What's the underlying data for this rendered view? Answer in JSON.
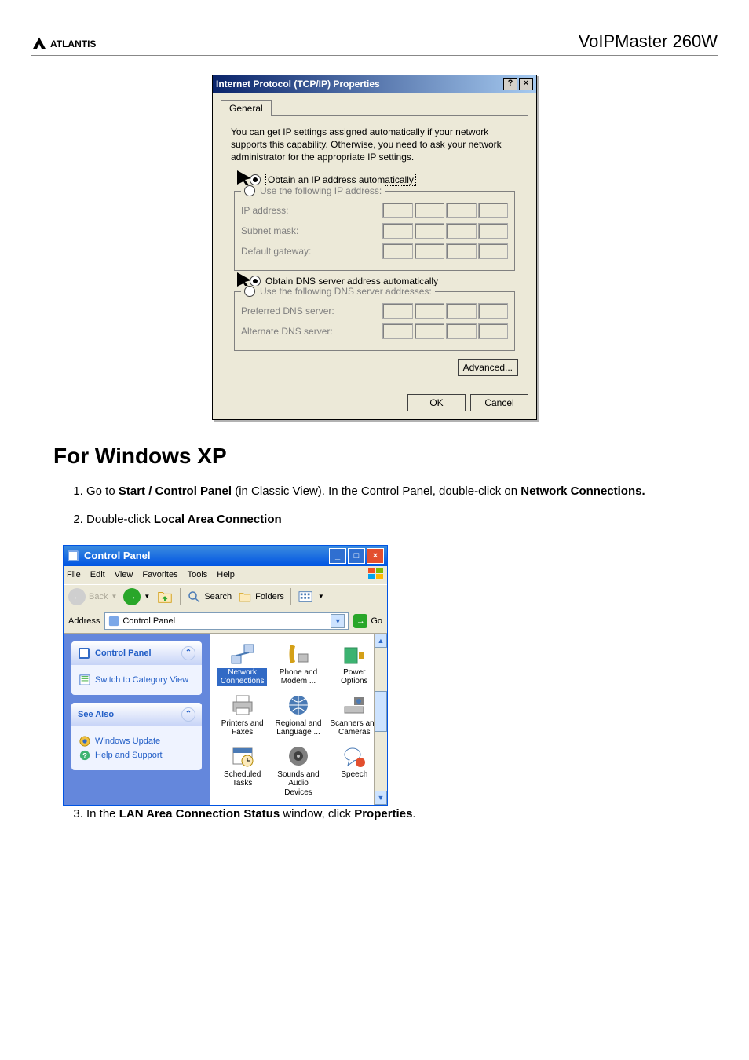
{
  "header": {
    "logo_brand": "ATLANTIS",
    "product": "VoIPMaster 260W"
  },
  "dialog": {
    "title": "Internet Protocol (TCP/IP) Properties",
    "help_btn": "?",
    "close_btn": "×",
    "tab": "General",
    "description": "You can get IP settings assigned automatically if your network supports this capability. Otherwise, you need to ask your network administrator for the appropriate IP settings.",
    "ip_auto": "Obtain an IP address automatically",
    "ip_manual": "Use the following IP address:",
    "ip_label": "IP address:",
    "subnet_label": "Subnet mask:",
    "gateway_label": "Default gateway:",
    "dns_auto": "Obtain DNS server address automatically",
    "dns_manual": "Use the following DNS server addresses:",
    "pref_dns": "Preferred DNS server:",
    "alt_dns": "Alternate DNS server:",
    "advanced": "Advanced...",
    "ok": "OK",
    "cancel": "Cancel"
  },
  "section_heading": "For Windows XP",
  "steps": {
    "s1a": "Go to ",
    "s1b": "Start / Control Panel",
    "s1c": " (in Classic View). In the Control Panel, double-click on ",
    "s1d": "Network Connections.",
    "s2a": "Double-click ",
    "s2b": "Local Area Connection",
    "s3a": "In the ",
    "s3b": "LAN Area Connection Status",
    "s3c": " window, click ",
    "s3d": "Properties",
    "s3e": "."
  },
  "cp": {
    "title": "Control Panel",
    "menus": {
      "file": "File",
      "edit": "Edit",
      "view": "View",
      "favorites": "Favorites",
      "tools": "Tools",
      "help": "Help"
    },
    "tb": {
      "back": "Back",
      "search": "Search",
      "folders": "Folders"
    },
    "address_lbl": "Address",
    "address_val": "Control Panel",
    "go": "Go",
    "side_cp": "Control Panel",
    "side_switch": "Switch to Category View",
    "side_see": "See Also",
    "side_wu": "Windows Update",
    "side_help": "Help and Support",
    "icons": {
      "network": "Network Connections",
      "phone": "Phone and Modem ...",
      "power": "Power Options",
      "printers": "Printers and Faxes",
      "regional": "Regional and Language ...",
      "scanners": "Scanners and Cameras",
      "sched": "Scheduled Tasks",
      "sounds": "Sounds and Audio Devices",
      "speech": "Speech"
    }
  }
}
